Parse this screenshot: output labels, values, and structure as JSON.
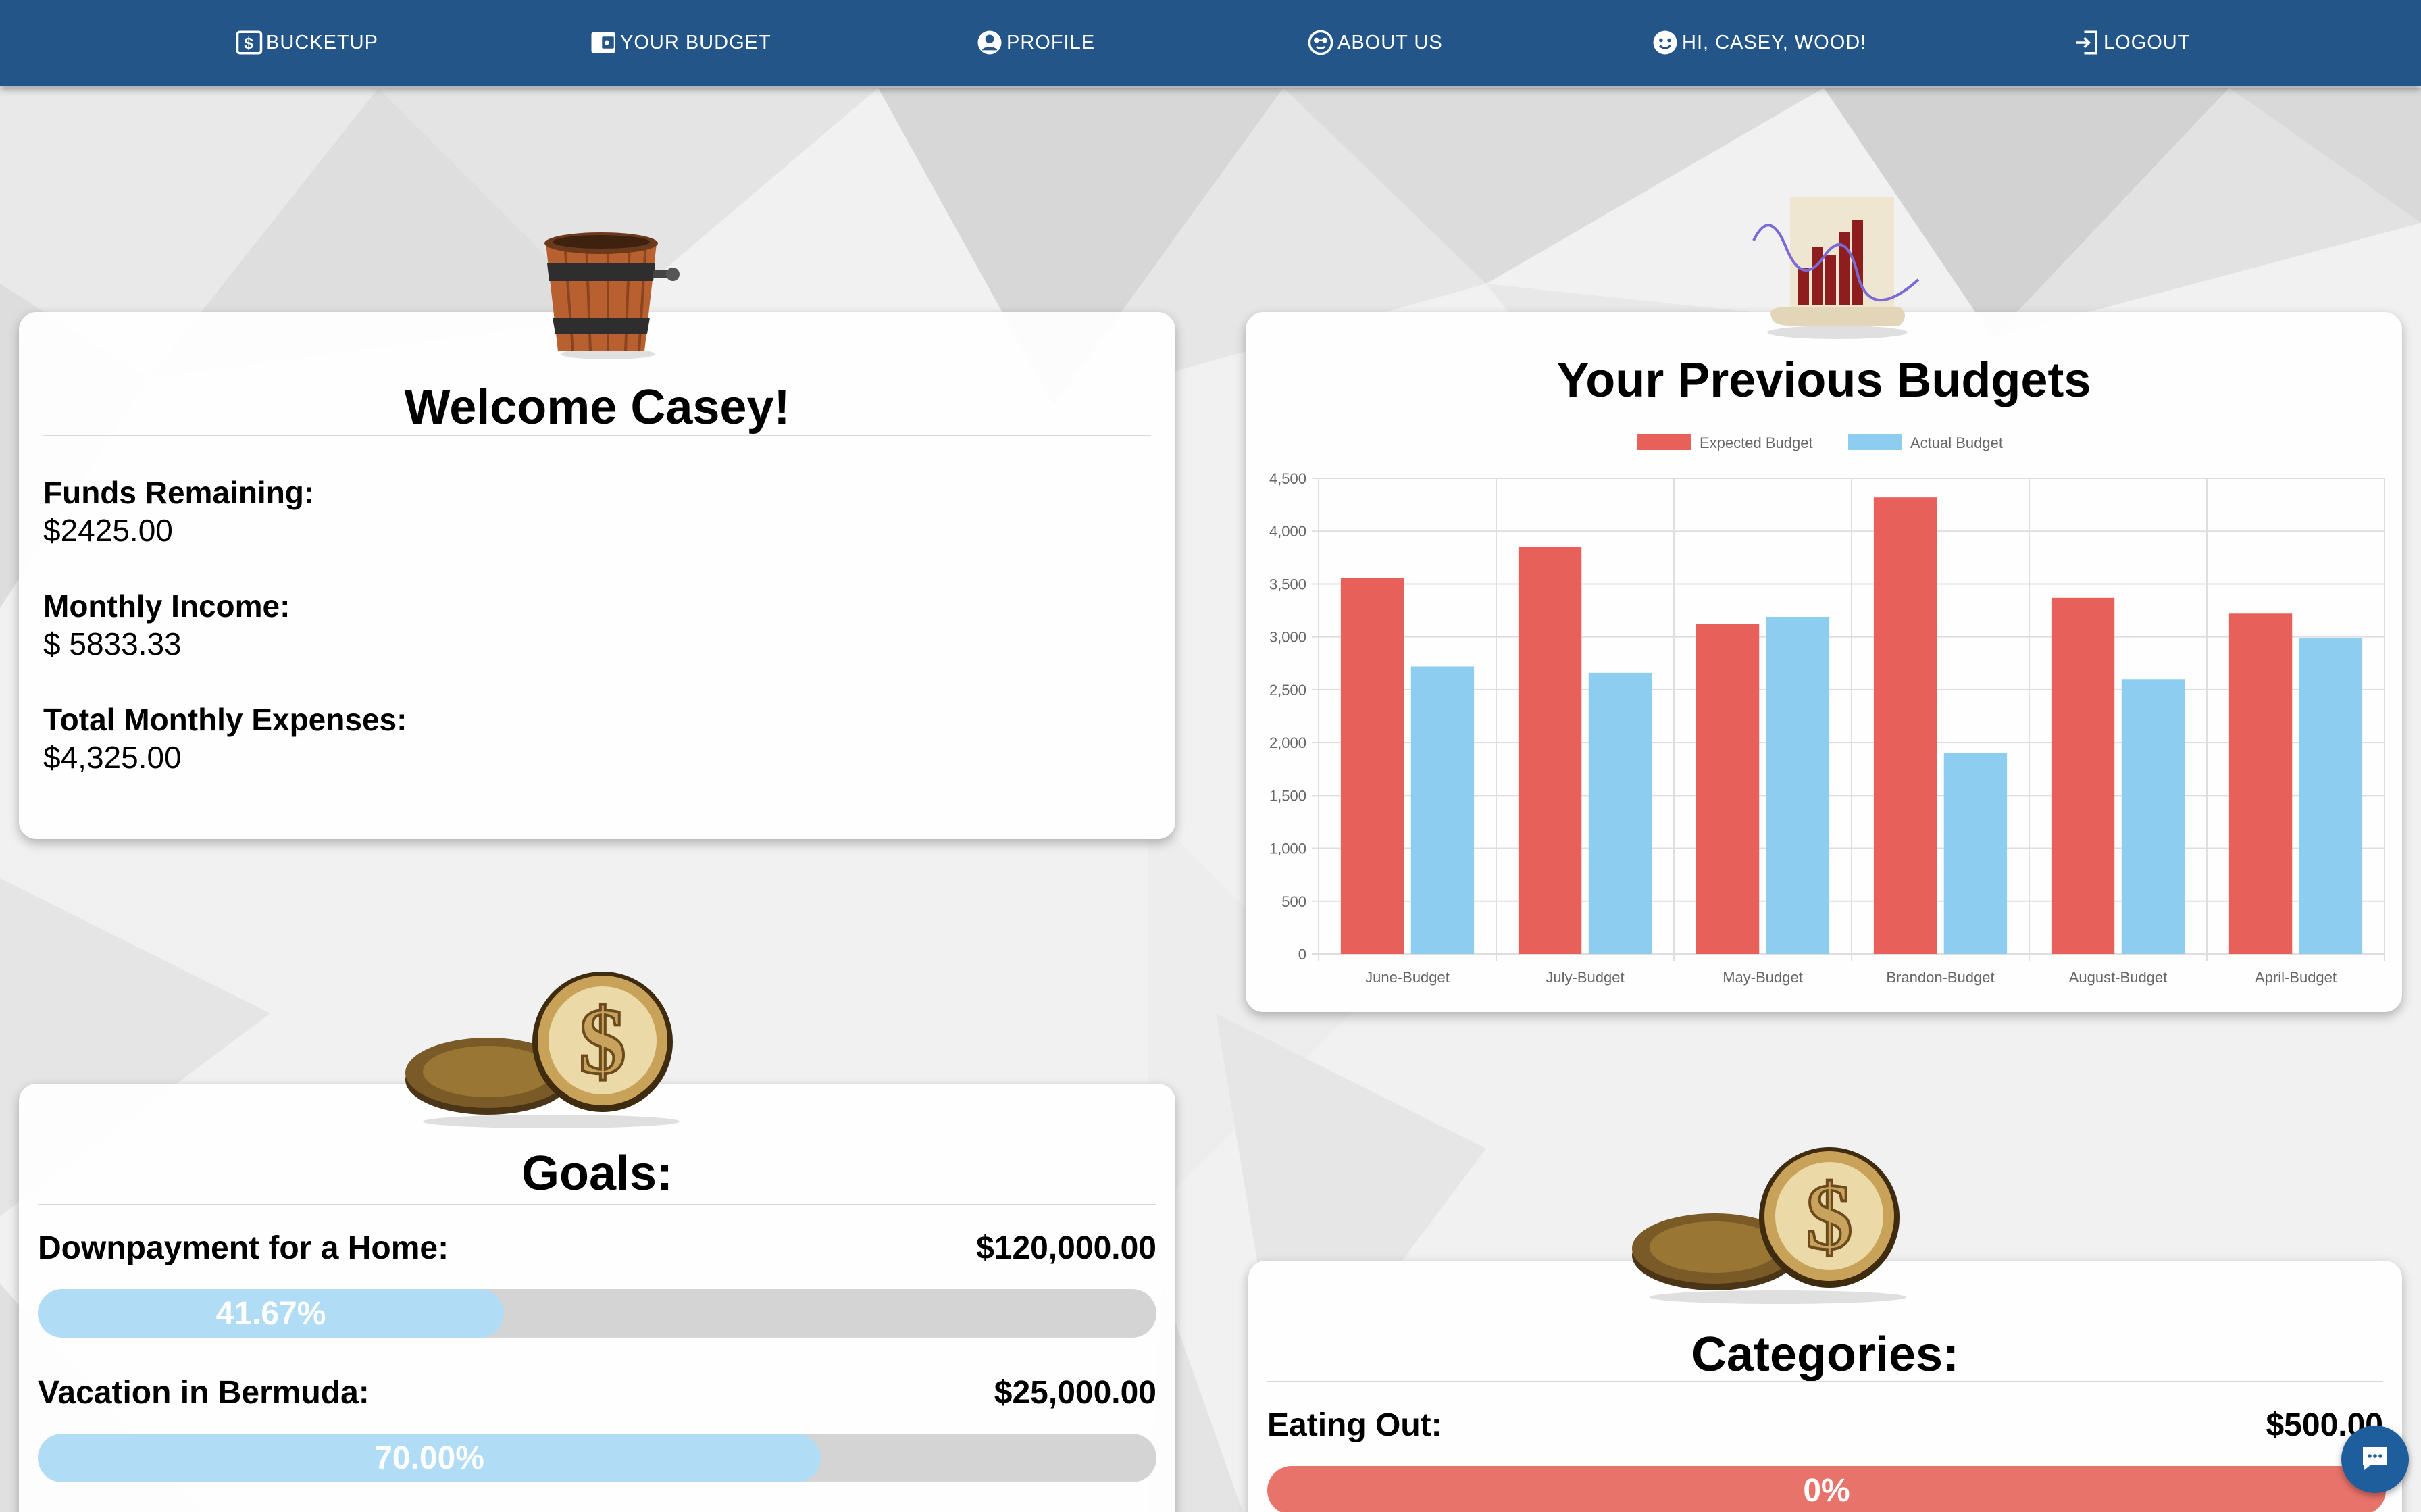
{
  "nav": {
    "items": [
      {
        "label": "BUCKETUP",
        "icon": "money-bill-icon"
      },
      {
        "label": "YOUR BUDGET",
        "icon": "wallet-icon"
      },
      {
        "label": "PROFILE",
        "icon": "user-circle-icon"
      },
      {
        "label": "ABOUT US",
        "icon": "face-glasses-icon"
      },
      {
        "label": "HI, CASEY, WOOD!",
        "icon": "smiley-icon"
      },
      {
        "label": "LOGOUT",
        "icon": "logout-icon"
      }
    ]
  },
  "welcome": {
    "title": "Welcome Casey!",
    "funds_label": "Funds Remaining:",
    "funds_value": "$2425.00",
    "income_label": "Monthly Income:",
    "income_value": "$ 5833.33",
    "expenses_label": "Total Monthly Expenses:",
    "expenses_value": "$4,325.00"
  },
  "goals": {
    "title": "Goals:",
    "items": [
      {
        "name": "Downpayment for a Home:",
        "amount": "$120,000.00",
        "progress_label": "41.67%",
        "progress": 0.4167
      },
      {
        "name": "Vacation in Bermuda:",
        "amount": "$25,000.00",
        "progress_label": "70.00%",
        "progress": 0.7
      }
    ]
  },
  "categories": {
    "title": "Categories:",
    "items": [
      {
        "name": "Eating Out:",
        "amount": "$500.00",
        "progress_label": "0%",
        "progress": 0
      }
    ]
  },
  "budgets_title": "Your Previous Budgets",
  "colors": {
    "nav": "#245589",
    "expected": "#e8605a",
    "actual": "#8dcef0",
    "goal_fill": "#b0dcf6",
    "category_fill": "#e8736a",
    "track": "#d4d4d4"
  },
  "chart_data": {
    "type": "bar",
    "categories": [
      "June-Budget",
      "July-Budget",
      "May-Budget",
      "Brandon-Budget",
      "August-Budget",
      "April-Budget"
    ],
    "series": [
      {
        "name": "Expected Budget",
        "values": [
          3560,
          3850,
          3120,
          4320,
          3370,
          3220
        ]
      },
      {
        "name": "Actual Budget",
        "values": [
          2720,
          2660,
          3190,
          1900,
          2600,
          2990
        ]
      }
    ],
    "ylim": [
      0,
      4500
    ],
    "yticks": [
      "0",
      "500",
      "1,000",
      "1,500",
      "2,000",
      "2,500",
      "3,000",
      "3,500",
      "4,000",
      "4,500"
    ],
    "legend": "top",
    "grid": true
  }
}
